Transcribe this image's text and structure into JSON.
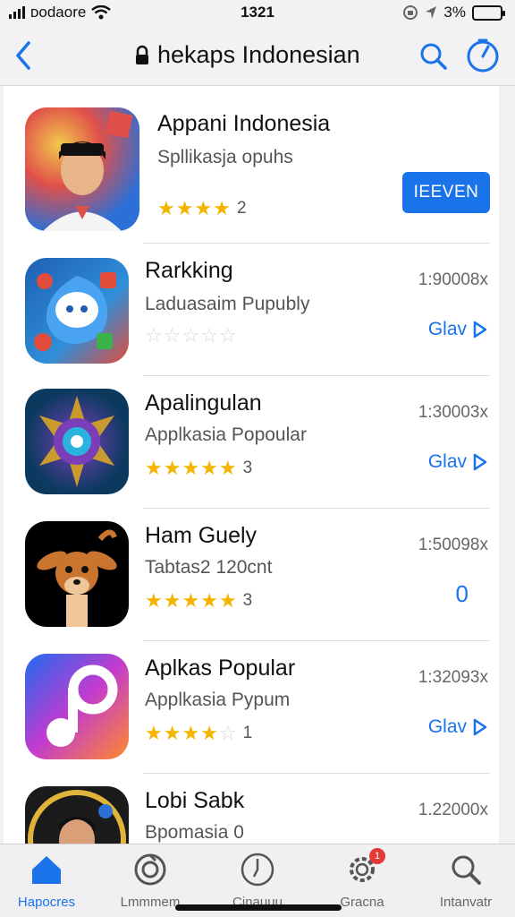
{
  "status": {
    "carrier": "ᴅᴏdaore",
    "time": "1321",
    "battery": "3%"
  },
  "header": {
    "title": "hekaps Indonesian"
  },
  "apps": [
    {
      "name": "Appani Indonesia",
      "subtitle": "Spllikasja opuhs",
      "rating": 4,
      "rating_count": "2",
      "action_label": "IEEVEN",
      "icon": "portrait-icon",
      "colors": [
        "#2c6fd6",
        "#e0504a",
        "#f2c94c"
      ]
    },
    {
      "name": "Rarkking",
      "subtitle": "Laduasaim Pupubly",
      "rating": 0,
      "rating_count": "",
      "size": "1:90008x",
      "action_label": "Glav",
      "icon": "chat-bird-icon",
      "colors": [
        "#1e5fb3",
        "#e24c3b",
        "#2f8fd8"
      ]
    },
    {
      "name": "Apalingulan",
      "subtitle": "Applkasia Popoular",
      "rating": 5,
      "rating_count": "3",
      "size": "1:30003x",
      "action_label": "Glav",
      "icon": "sun-compass-icon",
      "colors": [
        "#0b3a5e",
        "#c99a2e",
        "#7a3fb8"
      ]
    },
    {
      "name": "Ham Guely",
      "subtitle": "Tabtas2 120cnt",
      "rating": 5,
      "rating_count": "3",
      "size": "1:50098x",
      "action_label": "0",
      "icon": "deer-icon",
      "colors": [
        "#000000",
        "#c9742f",
        "#f0c79a"
      ]
    },
    {
      "name": "Aplkas Popular",
      "subtitle": "Applkasia Pypum",
      "rating": 4,
      "rating_count": "1",
      "size": "1:32093x",
      "action_label": "Glav",
      "icon": "music-note-icon",
      "colors": [
        "#1e6bf0",
        "#c23bd0",
        "#ff8a2a"
      ]
    },
    {
      "name": "Lobi Sabk",
      "subtitle": "Bpomasia 0",
      "rating": 0,
      "rating_count": "",
      "size": "1.22000x",
      "action_label": "",
      "icon": "avatar-icon",
      "colors": [
        "#1b1b1b",
        "#e0b43a",
        "#7aa9c9"
      ]
    }
  ],
  "tabs": [
    {
      "label": "Hapocres",
      "icon": "home-icon",
      "active": true
    },
    {
      "label": "Lmmmem",
      "icon": "refresh-icon",
      "active": false
    },
    {
      "label": "Cinauuu",
      "icon": "clock-icon",
      "active": false
    },
    {
      "label": "Gracna",
      "icon": "gear-icon",
      "active": false,
      "badge": "1"
    },
    {
      "label": "Intanvatr",
      "icon": "search-icon",
      "active": false
    }
  ],
  "accent_color": "#1a73e8"
}
